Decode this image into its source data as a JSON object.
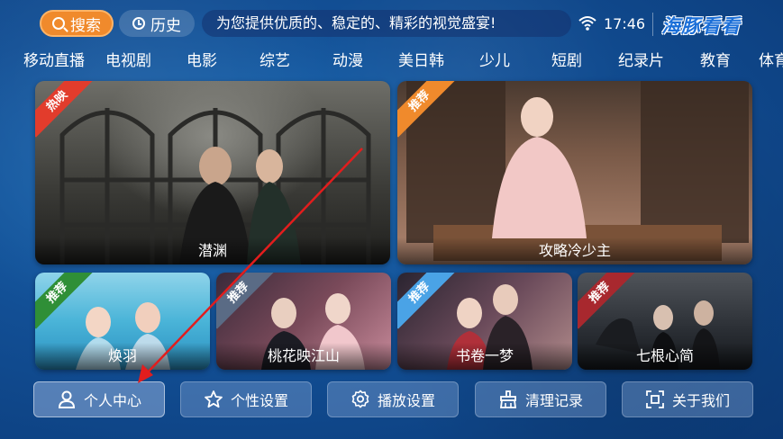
{
  "topbar": {
    "search_label": "搜索",
    "history_label": "历史",
    "banner_text": "为您提供优质的、稳定的、精彩的视觉盛宴!",
    "time": "17:46",
    "brand": "海豚看看"
  },
  "categories": [
    "移动直播",
    "电视剧",
    "电影",
    "综艺",
    "动漫",
    "美日韩",
    "少儿",
    "短剧",
    "纪录片",
    "教育",
    "体育"
  ],
  "tiles": [
    {
      "title": "潜渊",
      "badge": "热映"
    },
    {
      "title": "攻略冷少主",
      "badge": "推荐"
    },
    {
      "title": "焕羽",
      "badge": "推荐"
    },
    {
      "title": "桃花映江山",
      "badge": "推荐"
    },
    {
      "title": "书卷一梦",
      "badge": "推荐"
    },
    {
      "title": "七根心简",
      "badge": "推荐"
    }
  ],
  "bottom": {
    "profile": "个人中心",
    "personal": "个性设置",
    "playback": "播放设置",
    "clear": "清理记录",
    "about": "关于我们"
  },
  "colors": {
    "accent_orange": "#f08a2c",
    "badge_red": "#e23c2c",
    "badge_green": "#2f8f37",
    "arrow_red": "#e21d1d"
  }
}
